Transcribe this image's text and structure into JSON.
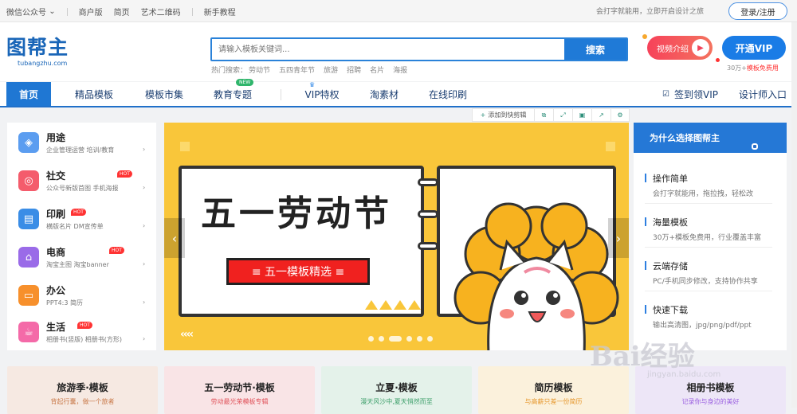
{
  "topbar": {
    "links": [
      "微信公众号",
      "商户版",
      "简页",
      "艺术二维码",
      "新手教程"
    ],
    "slogan": "会打字就能用，立即开启设计之旅",
    "login_label": "登录/注册"
  },
  "logo": {
    "text": "图帮主",
    "domain": "tubangzhu.com"
  },
  "search": {
    "placeholder": "请输入模板关键词...",
    "button": "搜索",
    "hot_label": "热门搜索：",
    "hot_terms": [
      "劳动节",
      "五四青年节",
      "旅游",
      "招聘",
      "名片",
      "海报"
    ]
  },
  "header_actions": {
    "video_label": "视频介绍",
    "vip_label": "开通VIP",
    "vip_note_prefix": "30万+",
    "vip_note_highlight": "模板免费用"
  },
  "nav": {
    "items": [
      "首页",
      "精品模板",
      "模板市集",
      "教育专题",
      "VIP特权",
      "淘素材",
      "在线印刷"
    ],
    "new_badge": "NEW",
    "right_items": [
      "签到领VIP",
      "设计师入口"
    ]
  },
  "toolbar": {
    "add_label": "添加到快剪辑"
  },
  "sidebar": {
    "items": [
      {
        "title": "用途",
        "sub": "企业管理运营   培训/教育",
        "icon": "cube-icon",
        "color": "#5b9df0",
        "hot": false
      },
      {
        "title": "社交",
        "sub": "公众号新版首图   手机海报",
        "icon": "chat-icon",
        "color": "#f45c6c",
        "hot": true
      },
      {
        "title": "印刷",
        "sub": "横版名片   DM宣传单",
        "icon": "paint-roller-icon",
        "color": "#3a8de6",
        "hot": true
      },
      {
        "title": "电商",
        "sub": "淘宝主图   淘宝banner",
        "icon": "shop-icon",
        "color": "#9a6be8",
        "hot": true
      },
      {
        "title": "办公",
        "sub": "PPT4:3   简历",
        "icon": "monitor-icon",
        "color": "#f7902c",
        "hot": false
      },
      {
        "title": "生活",
        "sub": "相册书(竖版)   相册书(方形)",
        "icon": "cup-icon",
        "color": "#f46aa8",
        "hot": true
      }
    ],
    "hot_label": "HOT"
  },
  "banner": {
    "title": "五一劳动节",
    "subtitle": "≡  五一模板精选  ≡",
    "bg_color": "#f9c63a"
  },
  "why": {
    "heading": "为什么选择图帮主",
    "items": [
      {
        "title": "操作简单",
        "desc": "会打字就能用，拖拉拽，轻松改"
      },
      {
        "title": "海量模板",
        "desc": "30万+模板免费用，行业覆盖丰富"
      },
      {
        "title": "云端存储",
        "desc": "PC/手机同步修改，支持协作共享"
      },
      {
        "title": "快速下载",
        "desc": "输出高清图，jpg/png/pdf/ppt"
      }
    ]
  },
  "cards": [
    {
      "title": "旅游季·模板",
      "sub": "背起行囊，做一个旅者",
      "bg": "#f6e9e2",
      "sub_color": "#c97a4a"
    },
    {
      "title": "五一劳动节·模板",
      "sub": "劳动最光荣模板专辑",
      "bg": "#f9e4e6",
      "sub_color": "#e0525a"
    },
    {
      "title": "立夏·模板",
      "sub": "漫天风沙中,夏天悄然而至",
      "bg": "#e4f2ea",
      "sub_color": "#3fa06c"
    },
    {
      "title": "简历模板",
      "sub": "与高薪只差一份简历",
      "bg": "#fbf1dc",
      "sub_color": "#e6962a"
    },
    {
      "title": "相册书模板",
      "sub": "记录你与身边的美好",
      "bg": "#ede6f7",
      "sub_color": "#9a5fe0"
    }
  ],
  "watermark": {
    "text": "Bai经验",
    "sub": "jingyan.baidu.com"
  }
}
